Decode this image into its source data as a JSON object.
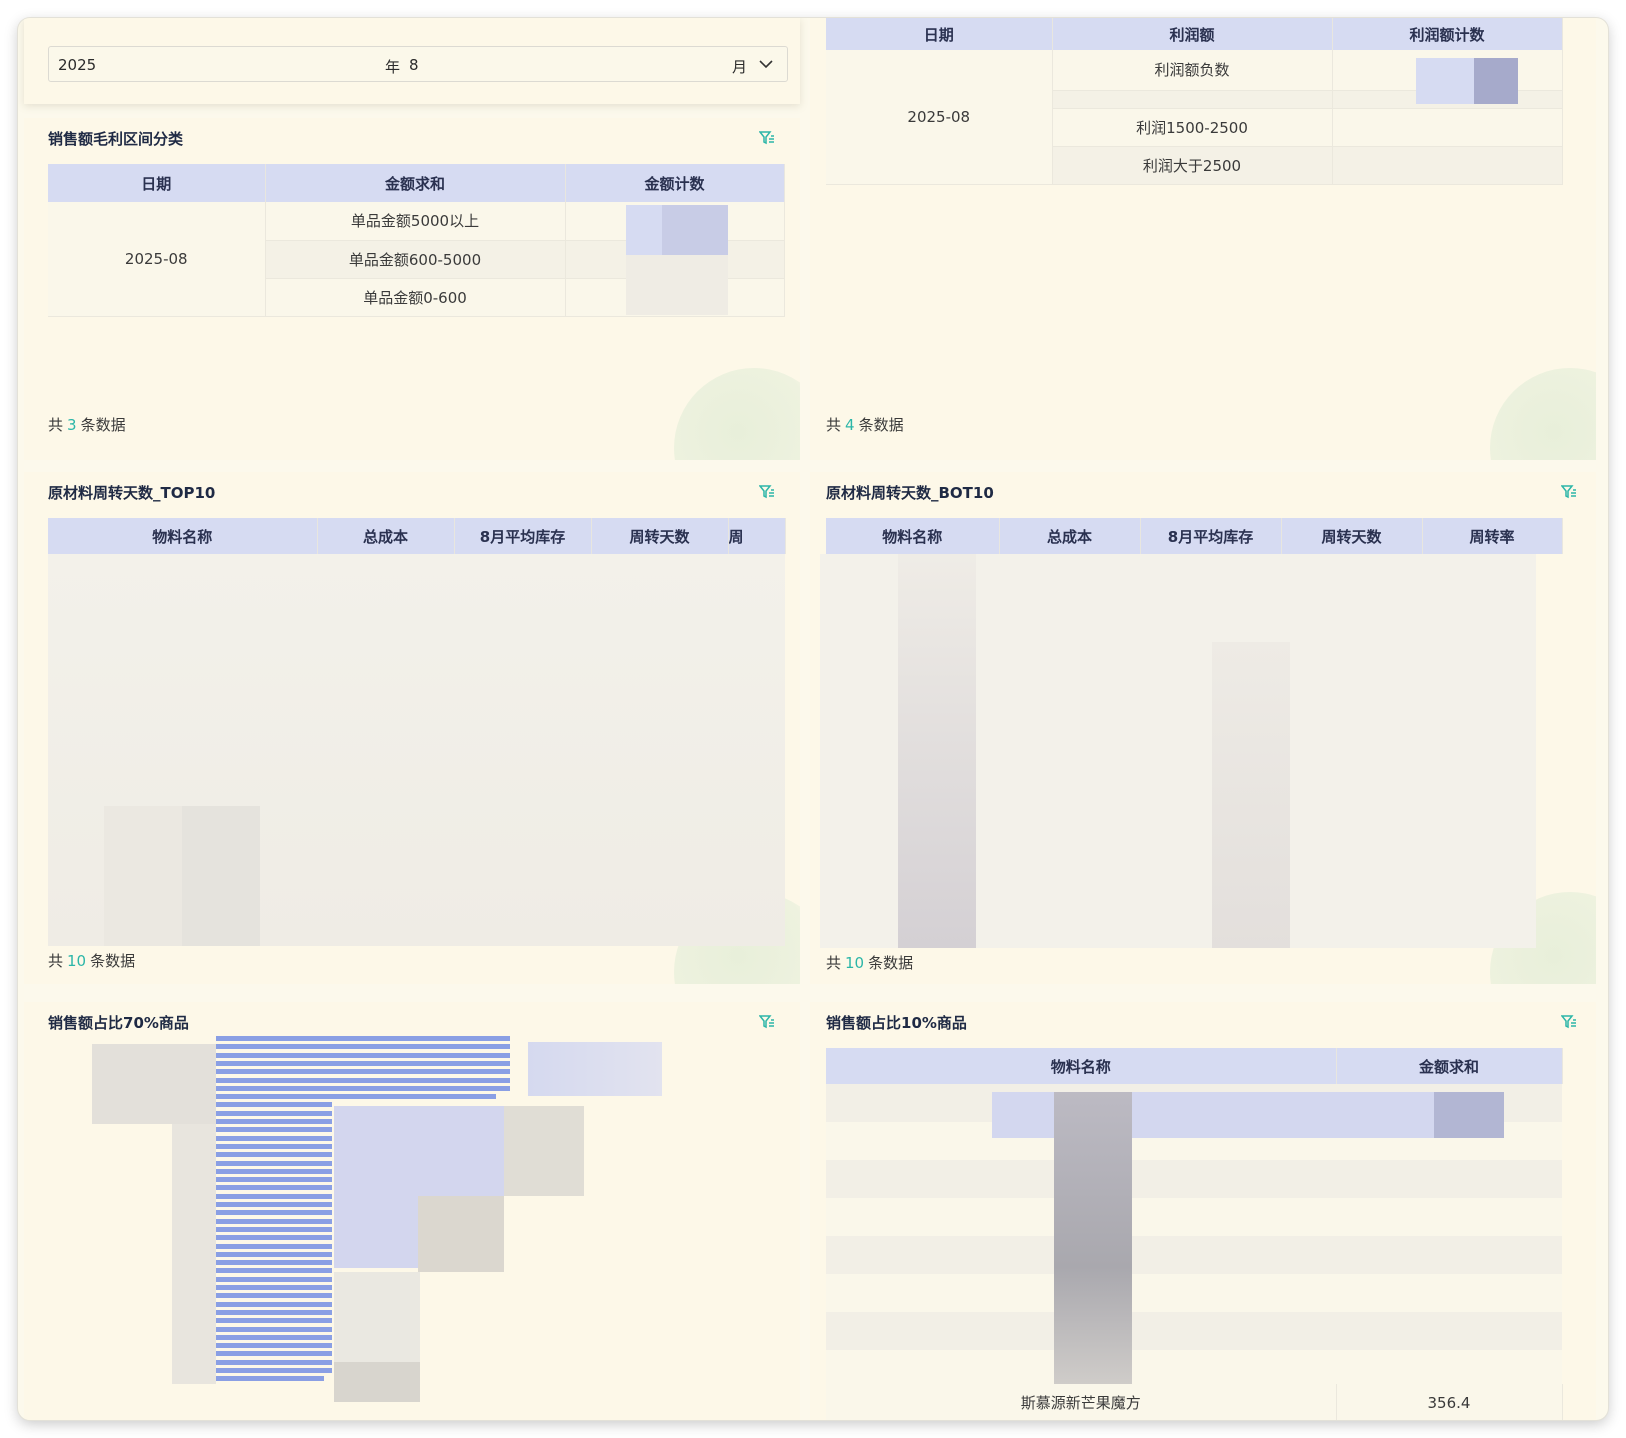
{
  "date_filter": {
    "year": "2025",
    "year_unit": "年",
    "month": "8",
    "month_unit": "月"
  },
  "margin_panel": {
    "title": "销售额毛利区间分类",
    "columns": [
      "日期",
      "金额求和",
      "金额计数"
    ],
    "date": "2025-08",
    "rows": [
      "单品金额5000以上",
      "单品金额600-5000",
      "单品金额0-600"
    ],
    "footer_prefix": "共",
    "footer_count": "3",
    "footer_suffix": "条数据"
  },
  "profit_panel": {
    "columns": [
      "日期",
      "利润额",
      "利润额计数"
    ],
    "date": "2025-08",
    "rows": [
      "利润额负数",
      "",
      "利润1500-2500",
      "利润大于2500"
    ],
    "footer_prefix": "共",
    "footer_count": "4",
    "footer_suffix": "条数据"
  },
  "top10_panel": {
    "title": "原材料周转天数_TOP10",
    "columns": [
      "物料名称",
      "总成本",
      "8月平均库存",
      "周转天数",
      "周"
    ],
    "footer_prefix": "共",
    "footer_count": "10",
    "footer_suffix": "条数据"
  },
  "bot10_panel": {
    "title": "原材料周转天数_BOT10",
    "columns": [
      "物料名称",
      "总成本",
      "8月平均库存",
      "周转天数",
      "周转率"
    ],
    "footer_prefix": "共",
    "footer_count": "10",
    "footer_suffix": "条数据"
  },
  "share70_panel": {
    "title": "销售额占比70%商品"
  },
  "share10_panel": {
    "title": "销售额占比10%商品",
    "columns": [
      "物料名称",
      "金额求和"
    ],
    "last_row": {
      "name": "斯慕源新芒果魔方",
      "value": "356.4"
    }
  },
  "colors": {
    "accent": "#2cb6a8",
    "header_bg": "#d6dbf2",
    "bar": "#8a9fe4"
  },
  "icons": [
    "filter-icon"
  ]
}
